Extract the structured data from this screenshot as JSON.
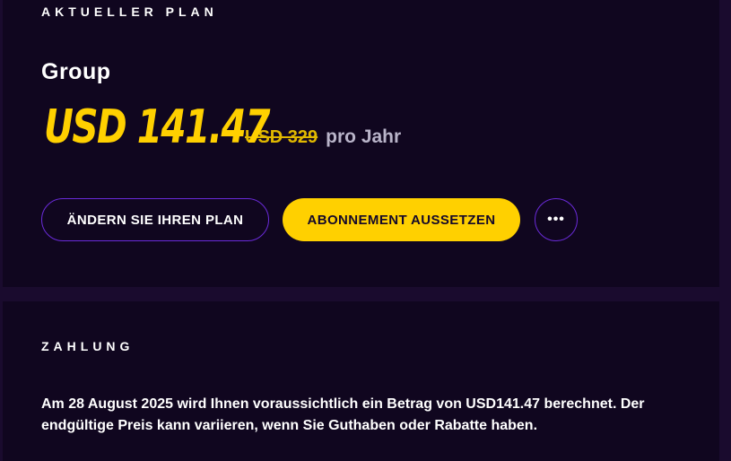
{
  "current_plan": {
    "heading": "AKTUELLER PLAN",
    "plan_name": "Group",
    "price_current": "USD 141.47",
    "price_original": "USD 329",
    "price_period": "pro Jahr",
    "actions": {
      "change_plan_label": "ÄNDERN SIE IHREN PLAN",
      "pause_subscription_label": "ABONNEMENT AUSSETZEN",
      "more_label": "•••"
    }
  },
  "payment": {
    "heading": "ZAHLUNG",
    "text": "Am 28 August 2025 wird Ihnen voraussichtlich ein Betrag von USD141.47 berechnet. Der endgültige Preis kann variieren, wenn Sie Guthaben oder Rabatte haben."
  },
  "colors": {
    "background": "#1a0b2e",
    "panel": "#10061f",
    "accent_yellow": "#ffd000",
    "accent_purple": "#6a2bd9"
  },
  "icons": {
    "more": "more-horizontal-icon"
  }
}
